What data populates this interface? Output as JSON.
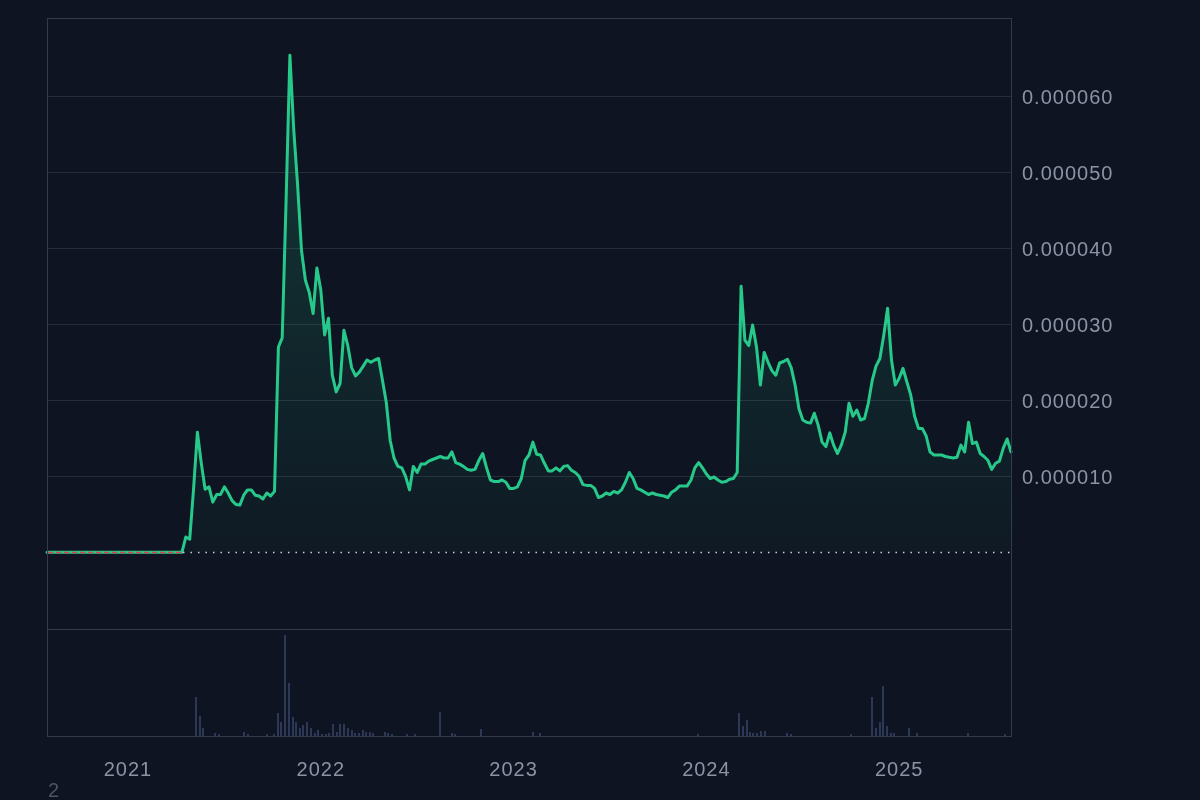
{
  "chart": {
    "chart_data": {
      "type": "area",
      "x": [
        2020.58,
        2021.28,
        2021.3,
        2021.32,
        2021.34,
        2021.36,
        2021.38,
        2021.4,
        2021.42,
        2021.44,
        2021.46,
        2021.48,
        2021.5,
        2021.52,
        2021.54,
        2021.56,
        2021.58,
        2021.6,
        2021.62,
        2021.64,
        2021.66,
        2021.68,
        2021.7,
        2021.72,
        2021.74,
        2021.76,
        2021.78,
        2021.8,
        2021.82,
        2021.84,
        2021.86,
        2021.88,
        2021.9,
        2021.92,
        2021.94,
        2021.96,
        2021.98,
        2022.0,
        2022.02,
        2022.04,
        2022.06,
        2022.08,
        2022.1,
        2022.12,
        2022.14,
        2022.16,
        2022.18,
        2022.2,
        2022.22,
        2022.24,
        2022.26,
        2022.28,
        2022.3,
        2022.32,
        2022.34,
        2022.36,
        2022.38,
        2022.4,
        2022.42,
        2022.44,
        2022.46,
        2022.48,
        2022.5,
        2022.52,
        2022.54,
        2022.56,
        2022.58,
        2022.6,
        2022.62,
        2022.64,
        2022.66,
        2022.68,
        2022.7,
        2022.72,
        2022.74,
        2022.76,
        2022.78,
        2022.8,
        2022.82,
        2022.84,
        2022.86,
        2022.88,
        2022.9,
        2022.92,
        2022.94,
        2022.96,
        2022.98,
        2023.0,
        2023.02,
        2023.04,
        2023.06,
        2023.08,
        2023.1,
        2023.12,
        2023.14,
        2023.16,
        2023.18,
        2023.2,
        2023.22,
        2023.24,
        2023.26,
        2023.28,
        2023.3,
        2023.32,
        2023.34,
        2023.36,
        2023.38,
        2023.4,
        2023.42,
        2023.44,
        2023.46,
        2023.48,
        2023.5,
        2023.52,
        2023.54,
        2023.56,
        2023.58,
        2023.6,
        2023.62,
        2023.64,
        2023.66,
        2023.68,
        2023.7,
        2023.72,
        2023.74,
        2023.76,
        2023.78,
        2023.8,
        2023.82,
        2023.84,
        2023.86,
        2023.88,
        2023.9,
        2023.92,
        2023.94,
        2023.96,
        2023.98,
        2024.0,
        2024.02,
        2024.04,
        2024.06,
        2024.08,
        2024.1,
        2024.12,
        2024.14,
        2024.16,
        2024.18,
        2024.2,
        2024.22,
        2024.24,
        2024.26,
        2024.28,
        2024.3,
        2024.32,
        2024.34,
        2024.36,
        2024.38,
        2024.4,
        2024.42,
        2024.44,
        2024.46,
        2024.48,
        2024.5,
        2024.52,
        2024.54,
        2024.56,
        2024.58,
        2024.6,
        2024.62,
        2024.64,
        2024.66,
        2024.68,
        2024.7,
        2024.72,
        2024.74,
        2024.76,
        2024.78,
        2024.8,
        2024.82,
        2024.84,
        2024.86,
        2024.88,
        2024.9,
        2024.92,
        2024.94,
        2024.96,
        2024.98,
        2025.0,
        2025.02,
        2025.04,
        2025.06,
        2025.08,
        2025.1,
        2025.12,
        2025.14,
        2025.16,
        2025.18,
        2025.2,
        2025.22,
        2025.24,
        2025.26,
        2025.28,
        2025.3,
        2025.32,
        2025.34,
        2025.36,
        2025.38,
        2025.4,
        2025.42,
        2025.44,
        2025.46,
        2025.48,
        2025.5,
        2025.52,
        2025.54,
        2025.56,
        2025.58
      ],
      "series": [
        {
          "color": "#27c98b",
          "values": [
            0,
            0,
            2e-06,
            1.7e-06,
            8.2e-06,
            1.58e-05,
            1.18e-05,
            8.3e-06,
            8.6e-06,
            6.6e-06,
            7.6e-06,
            7.6e-06,
            8.6e-06,
            7.8e-06,
            6.8e-06,
            6.3e-06,
            6.2e-06,
            7.5e-06,
            8.2e-06,
            8.2e-06,
            7.5e-06,
            7.4e-06,
            7e-06,
            7.8e-06,
            7.4e-06,
            8e-06,
            2.7e-05,
            2.82e-05,
            4.63e-05,
            6.54e-05,
            5.55e-05,
            4.83e-05,
            3.97e-05,
            3.58e-05,
            3.42e-05,
            3.14e-05,
            3.74e-05,
            3.45e-05,
            2.86e-05,
            3.08e-05,
            2.33e-05,
            2.11e-05,
            2.22e-05,
            2.92e-05,
            2.72e-05,
            2.43e-05,
            2.32e-05,
            2.37e-05,
            2.45e-05,
            2.53e-05,
            2.5e-05,
            2.53e-05,
            2.55e-05,
            2.26e-05,
            1.97e-05,
            1.47e-05,
            1.24e-05,
            1.13e-05,
            1.11e-05,
            1e-05,
            8.2e-06,
            1.13e-05,
            1.05e-05,
            1.16e-05,
            1.16e-05,
            1.2e-05,
            1.22e-05,
            1.24e-05,
            1.26e-05,
            1.24e-05,
            1.24e-05,
            1.32e-05,
            1.18e-05,
            1.16e-05,
            1.13e-05,
            1.09e-05,
            1.08e-05,
            1.09e-05,
            1.21e-05,
            1.3e-05,
            1.11e-05,
            9.5e-06,
            9.3e-06,
            9.3e-06,
            9.5e-06,
            9.2e-06,
            8.4e-06,
            8.4e-06,
            8.6e-06,
            9.7e-06,
            1.21e-05,
            1.28e-05,
            1.45e-05,
            1.29e-05,
            1.28e-05,
            1.17e-05,
            1.07e-05,
            1.07e-05,
            1.11e-05,
            1.07e-05,
            1.13e-05,
            1.14e-05,
            1.08e-05,
            1.05e-05,
            1e-05,
            8.9e-06,
            8.8e-06,
            8.8e-06,
            8.4e-06,
            7.2e-06,
            7.4e-06,
            7.8e-06,
            7.6e-06,
            8e-06,
            7.8e-06,
            8.2e-06,
            9.2e-06,
            1.05e-05,
            9.7e-06,
            8.4e-06,
            8.2e-06,
            7.9e-06,
            7.6e-06,
            7.8e-06,
            7.6e-06,
            7.5e-06,
            7.4e-06,
            7.2e-06,
            7.9e-06,
            8.2e-06,
            8.7e-06,
            8.7e-06,
            8.7e-06,
            9.5e-06,
            1.11e-05,
            1.18e-05,
            1.11e-05,
            1.03e-05,
            9.7e-06,
            9.9e-06,
            9.5e-06,
            9.2e-06,
            9.3e-06,
            9.6e-06,
            9.7e-06,
            1.05e-05,
            3.5e-05,
            2.79e-05,
            2.72e-05,
            2.99e-05,
            2.7e-05,
            2.2e-05,
            2.63e-05,
            2.5e-05,
            2.39e-05,
            2.33e-05,
            2.49e-05,
            2.51e-05,
            2.54e-05,
            2.43e-05,
            2.2e-05,
            1.89e-05,
            1.74e-05,
            1.71e-05,
            1.7e-05,
            1.83e-05,
            1.67e-05,
            1.45e-05,
            1.39e-05,
            1.57e-05,
            1.41e-05,
            1.3e-05,
            1.41e-05,
            1.58e-05,
            1.96e-05,
            1.79e-05,
            1.87e-05,
            1.74e-05,
            1.76e-05,
            1.96e-05,
            2.26e-05,
            2.45e-05,
            2.55e-05,
            2.86e-05,
            3.21e-05,
            2.53e-05,
            2.2e-05,
            2.29e-05,
            2.42e-05,
            2.24e-05,
            2.07e-05,
            1.79e-05,
            1.63e-05,
            1.63e-05,
            1.53e-05,
            1.32e-05,
            1.28e-05,
            1.28e-05,
            1.28e-05,
            1.26e-05,
            1.25e-05,
            1.24e-05,
            1.25e-05,
            1.41e-05,
            1.32e-05,
            1.71e-05,
            1.43e-05,
            1.45e-05,
            1.3e-05,
            1.26e-05,
            1.21e-05,
            1.09e-05,
            1.17e-05,
            1.2e-05,
            1.37e-05,
            1.49e-05,
            1.32e-05
          ]
        }
      ],
      "xlim": [
        2020.58,
        2025.58
      ],
      "ylim": [
        -1.01e-05,
        7.03e-05
      ],
      "xticks": [
        {
          "value": 2021,
          "label": "2021"
        },
        {
          "value": 2022,
          "label": "2022"
        },
        {
          "value": 2023,
          "label": "2023"
        },
        {
          "value": 2024,
          "label": "2024"
        },
        {
          "value": 2025,
          "label": "2025"
        }
      ],
      "yticks": [
        {
          "value": 6e-05,
          "label": "0.000060"
        },
        {
          "value": 5e-05,
          "label": "0.000050"
        },
        {
          "value": 4e-05,
          "label": "0.000040"
        },
        {
          "value": 3e-05,
          "label": "0.000030"
        },
        {
          "value": 2e-05,
          "label": "0.000020"
        },
        {
          "value": 1e-05,
          "label": "0.000010"
        }
      ],
      "grid": true,
      "ref_lines": [
        {
          "axis": "y",
          "value": 0,
          "color": "#cfd3dc"
        }
      ]
    }
  },
  "footer_label": "2"
}
